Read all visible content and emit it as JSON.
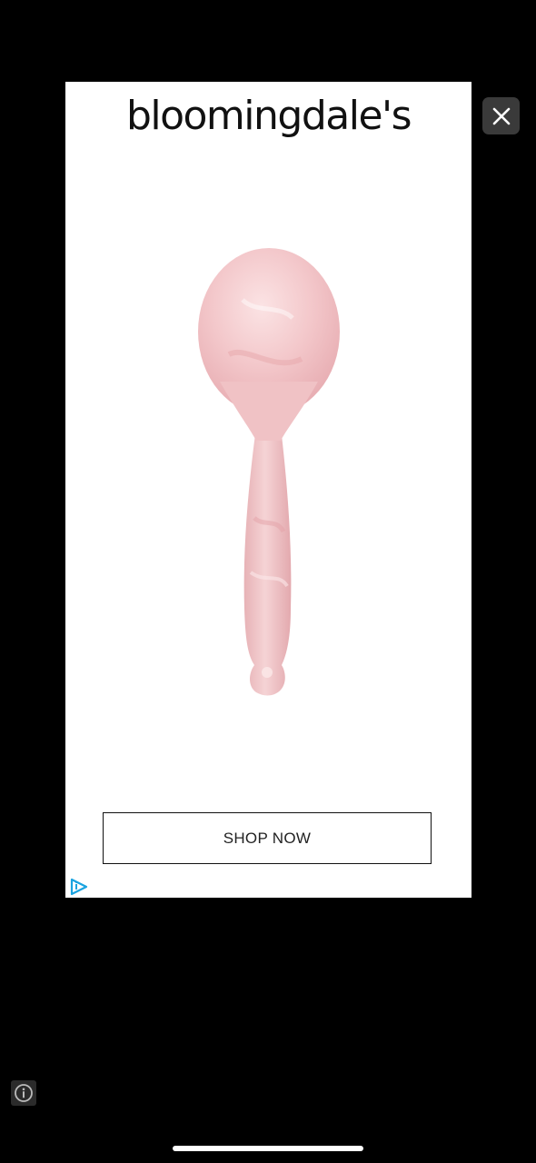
{
  "ad": {
    "brand_name": "bloomingdale's",
    "cta_label": "SHOP NOW",
    "product_image": "rose-quartz-facial-tool",
    "product_color": "#f2c4c8"
  },
  "controls": {
    "close_icon": "close-icon",
    "info_icon": "info-icon",
    "adchoices_icon": "adchoices-icon"
  },
  "colors": {
    "background": "#000000",
    "card": "#ffffff",
    "close_button_bg": "#3a3a3a",
    "adchoices_blue": "#1aa3e0"
  }
}
